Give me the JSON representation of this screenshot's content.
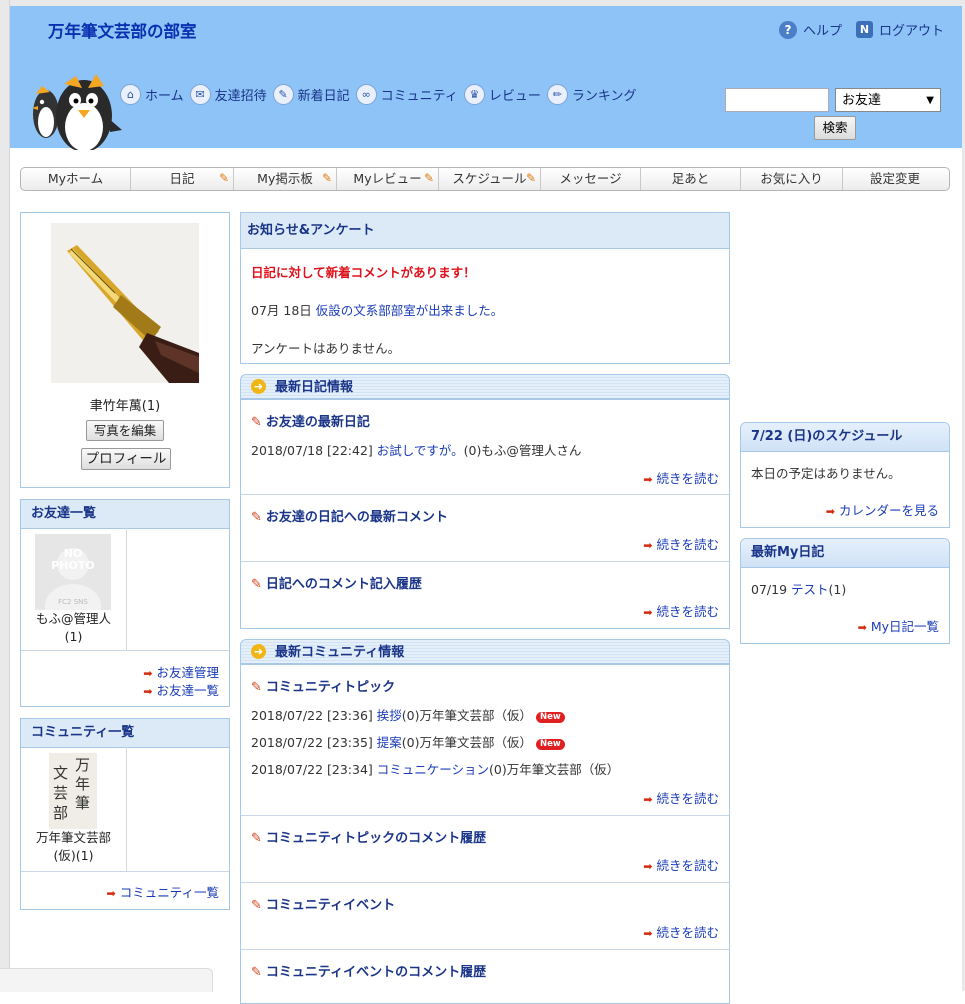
{
  "header": {
    "site_title": "万年筆文芸部の部室",
    "help": "ヘルプ",
    "logout": "ログアウト",
    "nav": [
      {
        "label": "ホーム",
        "icon": "home-icon"
      },
      {
        "label": "友達招待",
        "icon": "envelope-icon"
      },
      {
        "label": "新着日記",
        "icon": "diary-icon"
      },
      {
        "label": "コミュニティ",
        "icon": "community-icon"
      },
      {
        "label": "レビュー",
        "icon": "crown-icon"
      },
      {
        "label": "ランキング",
        "icon": "pencil-icon"
      }
    ],
    "search": {
      "input_value": "",
      "select_value": "お友達",
      "button": "検索"
    }
  },
  "tabs": [
    "Myホーム",
    "日記",
    "My掲示板",
    "Myレビュー",
    "スケジュール",
    "メッセージ",
    "足あと",
    "お気に入り",
    "設定変更"
  ],
  "profile": {
    "name": "聿竹年萬(1)",
    "edit_photo": "写真を編集",
    "profile_button": "プロフィール"
  },
  "friends": {
    "title": "お友達一覧",
    "nophoto_line1": "NO",
    "nophoto_line2": "PHOTO",
    "nophoto_brand": "FC2 SNS",
    "item_name": "もふ@管理人",
    "item_count": "(1)",
    "manage": "お友達管理",
    "list": "お友達一覧"
  },
  "communities": {
    "title": "コミュニティ一覧",
    "item_name": "万年筆文芸部",
    "item_sub": "(仮)(1)",
    "list": "コミュニティ一覧",
    "calligraphy": [
      "万",
      "年",
      "文",
      "筆",
      "芸",
      "部"
    ]
  },
  "notice": {
    "title": "お知らせ&アンケート",
    "alert": "日記に対して新着コメントがあります！",
    "date": "07月 18日",
    "news_link": "仮設の文系部部室が出来ました。",
    "survey": "アンケートはありません。"
  },
  "diary": {
    "title": "最新日記情報",
    "friends_diary_title": "お友達の最新日記",
    "friends_diary_entry": {
      "datetime": "2018/07/18 [22:42]",
      "link": "お試しですが。",
      "suffix": "(0)もふ@管理人さん"
    },
    "comments_title": "お友達の日記への最新コメント",
    "history_title": "日記へのコメント記入履歴",
    "read_more": "続きを読む"
  },
  "community_info": {
    "title": "最新コミュニティ情報",
    "topic_title": "コミュニティトピック",
    "topics": [
      {
        "datetime": "2018/07/22 [23:36]",
        "link": "挨拶",
        "suffix": "(0)万年筆文芸部（仮）",
        "new": "New"
      },
      {
        "datetime": "2018/07/22 [23:35]",
        "link": "提案",
        "suffix": "(0)万年筆文芸部（仮）",
        "new": "New"
      },
      {
        "datetime": "2018/07/22 [23:34]",
        "link": "コミュニケーション",
        "suffix": "(0)万年筆文芸部（仮）",
        "new": ""
      }
    ],
    "topic_comment_title": "コミュニティトピックのコメント履歴",
    "event_title": "コミュニティイベント",
    "event_comment_title": "コミュニティイベントのコメント履歴",
    "read_more": "続きを読む"
  },
  "schedule": {
    "title": "7/22 (日)のスケジュール",
    "empty": "本日の予定はありません。",
    "calendar_link": "カレンダーを見る"
  },
  "my_diary": {
    "title": "最新My日記",
    "date": "07/19",
    "link": "テスト",
    "count": "(1)",
    "list_link": "My日記一覧"
  }
}
